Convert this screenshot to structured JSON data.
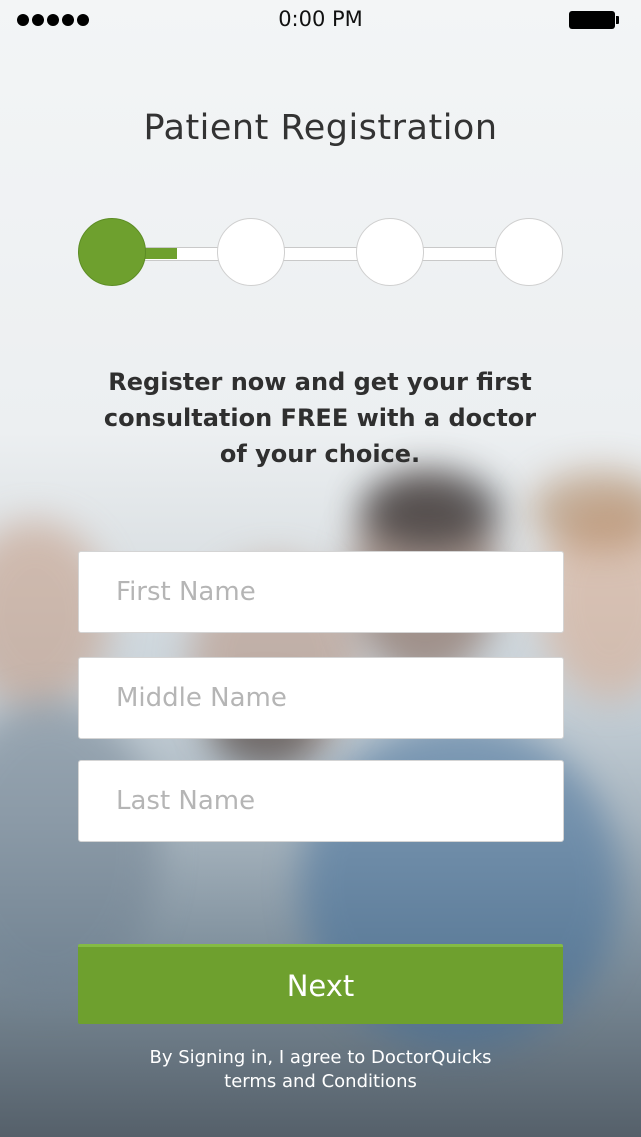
{
  "status_bar": {
    "time": "0:00 PM"
  },
  "title": "Patient Registration",
  "stepper": {
    "total_steps": 4,
    "current_step": 1,
    "progress_fraction": 0.15
  },
  "promo": {
    "line1": "Register now and get your first",
    "line2": "consultation FREE with a doctor",
    "line3": "of your choice."
  },
  "form": {
    "first_name": {
      "value": "",
      "placeholder": "First Name"
    },
    "middle_name": {
      "value": "",
      "placeholder": "Middle Name"
    },
    "last_name": {
      "value": "",
      "placeholder": "Last Name"
    }
  },
  "next_label": "Next",
  "terms": {
    "line1": "By Signing in, I agree to DoctorQuicks",
    "line2": "terms and Conditions"
  },
  "colors": {
    "accent": "#6ea02e",
    "background_top": "#f3f5f6"
  }
}
